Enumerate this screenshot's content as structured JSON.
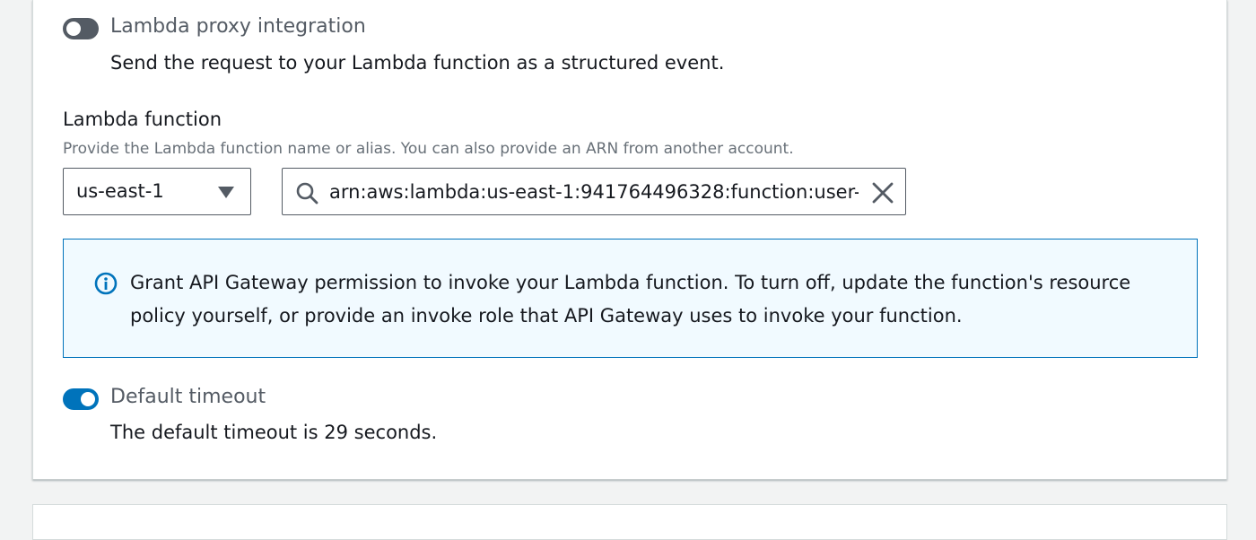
{
  "proxy_integration": {
    "label": "Lambda proxy integration",
    "description": "Send the request to your Lambda function as a structured event.",
    "enabled": false
  },
  "lambda_function": {
    "label": "Lambda function",
    "description": "Provide the Lambda function name or alias. You can also provide an ARN from another account.",
    "region": "us-east-1",
    "search_value": "arn:aws:lambda:us-east-1:941764496328:function:user-"
  },
  "permission_alert": {
    "text": "Grant API Gateway permission to invoke your Lambda function. To turn off, update the function's resource policy yourself, or provide an invoke role that API Gateway uses to invoke your function."
  },
  "default_timeout": {
    "label": "Default timeout",
    "description": "The default timeout is 29 seconds.",
    "enabled": true
  },
  "icons": {
    "search": "search-icon",
    "clear": "close-icon",
    "info": "info-icon",
    "dropdown": "caret-down-icon"
  },
  "colors": {
    "accent": "#0073bb",
    "toggle_off": "#545b64",
    "info_background": "#f1faff"
  }
}
